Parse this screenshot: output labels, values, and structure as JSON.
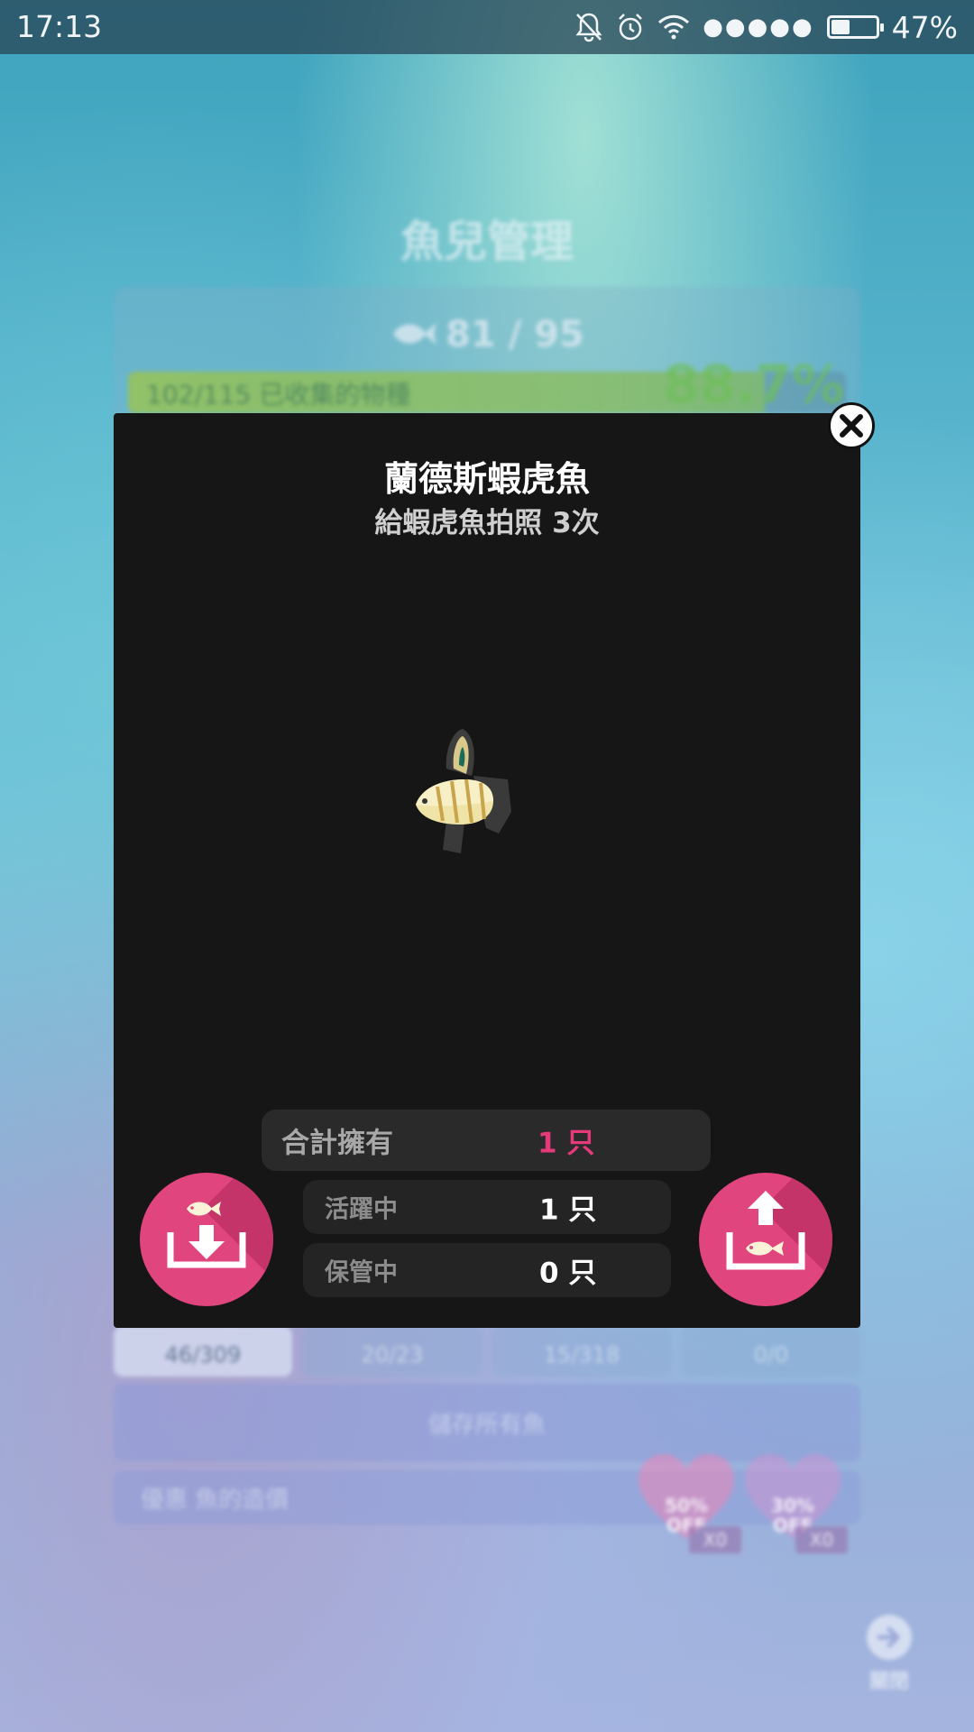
{
  "status_bar": {
    "time": "17:13",
    "battery_percent_text": "47%",
    "battery_level": 0.47,
    "icons": [
      "bell-off-icon",
      "alarm-icon",
      "wifi-icon",
      "signal-icon",
      "battery-icon"
    ]
  },
  "background": {
    "title": "魚兒管理",
    "fish_count": "81 / 95",
    "collection_text": "102/115 已收集的物種",
    "collection_percent": "88.7%",
    "collection_fraction": 0.887,
    "tabs": [
      {
        "label": "46/309",
        "active": true
      },
      {
        "label": "20/23",
        "active": false
      },
      {
        "label": "15/318",
        "active": false
      },
      {
        "label": "0/0",
        "active": false
      }
    ],
    "save_all_label": "儲存所有魚",
    "discount_label": "優惠 魚的造價",
    "hearts": [
      {
        "label": "50%\nOFF",
        "count": "X0"
      },
      {
        "label": "30%\nOFF",
        "count": "X0"
      }
    ],
    "close_label": "關閉"
  },
  "modal": {
    "title": "蘭德斯蝦虎魚",
    "subtitle": "給蝦虎魚拍照 3次",
    "stats": {
      "total_label": "合計擁有",
      "total_value": "1 只",
      "active_label": "活躍中",
      "active_value": "1 只",
      "stored_label": "保管中",
      "stored_value": "0 只"
    },
    "store_button_icon": "store-fish-icon",
    "release_button_icon": "release-fish-icon",
    "close_icon": "close-icon",
    "accent_color": "#e0457d",
    "value_highlight_color": "#e6397a"
  }
}
